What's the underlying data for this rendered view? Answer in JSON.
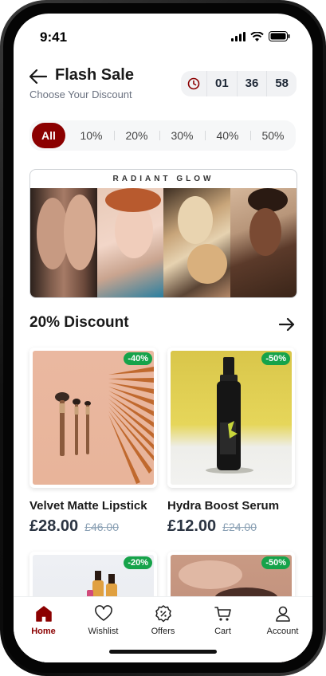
{
  "status_bar": {
    "time": "9:41"
  },
  "header": {
    "title": "Flash Sale",
    "subtitle": "Choose Your Discount",
    "timer": {
      "hours": "01",
      "minutes": "36",
      "seconds": "58"
    }
  },
  "filters": {
    "options": [
      "All",
      "10%",
      "20%",
      "30%",
      "40%",
      "50%"
    ],
    "selected": "All"
  },
  "banner": {
    "title": "RADIANT GLOW"
  },
  "section": {
    "title": "20% Discount"
  },
  "products": [
    {
      "name": "Velvet Matte Lipstick",
      "price": "£28.00",
      "old_price": "£46.00",
      "badge": "-40%"
    },
    {
      "name": "Hydra Boost Serum",
      "price": "£12.00",
      "old_price": "£24.00",
      "badge": "-50%"
    },
    {
      "name": "",
      "price": "",
      "old_price": "",
      "badge": "-20%"
    },
    {
      "name": "",
      "price": "",
      "old_price": "",
      "badge": "-50%"
    }
  ],
  "bottom_nav": {
    "items": [
      {
        "label": "Home",
        "icon": "home-icon",
        "active": true
      },
      {
        "label": "Wishlist",
        "icon": "heart-icon",
        "active": false
      },
      {
        "label": "Offers",
        "icon": "discount-badge-icon",
        "active": false
      },
      {
        "label": "Cart",
        "icon": "cart-icon",
        "active": false
      },
      {
        "label": "Account",
        "icon": "user-icon",
        "active": false
      }
    ]
  },
  "colors": {
    "accent": "#8b0000",
    "badge": "#16a34a",
    "price": "#2b3442",
    "old_price": "#8aa0b4"
  }
}
